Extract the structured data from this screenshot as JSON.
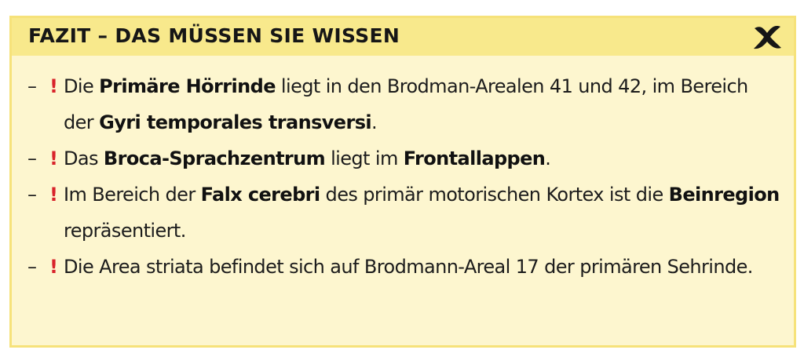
{
  "header": {
    "title": "FAZIT – DAS MÜSSEN SIE WISSEN",
    "icon": "x-mark-icon"
  },
  "colors": {
    "background": "#fdf6cf",
    "header": "#f8e98c",
    "border": "#f6e27a",
    "accent_red": "#d8232a",
    "text": "#1c1c1c"
  },
  "bullet": {
    "dash": "–",
    "marker": "!"
  },
  "items": [
    {
      "p0": "Die ",
      "b0": "Primäre Hörrinde",
      "p1": " liegt in den Brodman-Arealen 41 und 42, im Bereich der ",
      "b1": "Gyri temporales transversi",
      "p2": "."
    },
    {
      "p0": "Das ",
      "b0": "Broca-Sprachzentrum",
      "p1": " liegt im ",
      "b1": "Frontallappen",
      "p2": "."
    },
    {
      "p0": "Im Bereich der ",
      "b0": "Falx cerebri",
      "p1": " des primär motorischen Kortex ist die ",
      "b1": "Beinregion",
      "p2": " repräsentiert."
    },
    {
      "p0": "Die Area striata befindet sich auf Brodmann-Areal 17 der primären Sehrinde."
    }
  ]
}
